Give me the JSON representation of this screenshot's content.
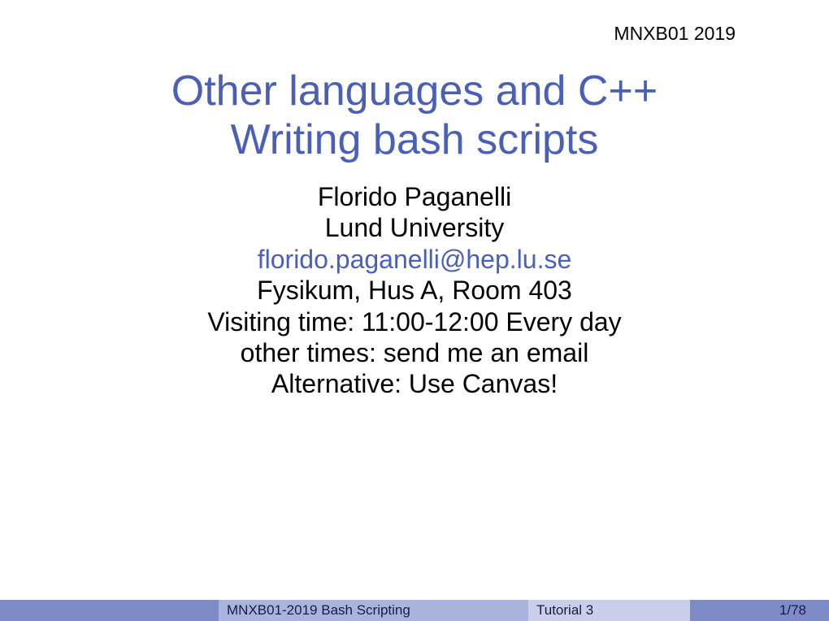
{
  "header": {
    "course_label": "MNXB01 2019"
  },
  "title": {
    "line1": "Other languages and C++",
    "line2": "Writing bash scripts"
  },
  "author": {
    "name": "Florido Paganelli",
    "institution": "Lund University",
    "email": "florido.paganelli@hep.lu.se",
    "location": "Fysikum, Hus A, Room 403",
    "visiting": "Visiting time: 11:00-12:00 Every day",
    "other_times": "other times: send me an email",
    "alternative": "Alternative: Use Canvas!"
  },
  "footer": {
    "course_title": "MNXB01-2019 Bash Scripting",
    "section": "Tutorial 3",
    "page": "1/78"
  }
}
